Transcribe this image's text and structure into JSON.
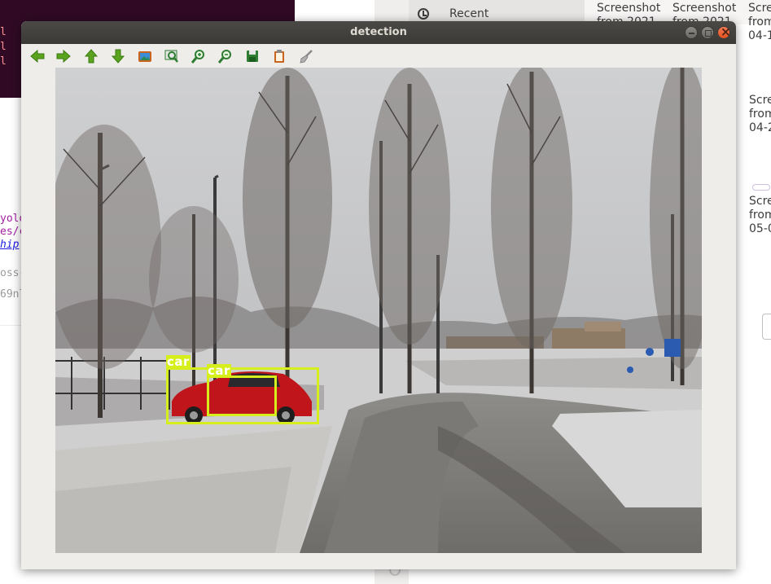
{
  "background": {
    "terminal_lines": [
      "l",
      "l",
      "l"
    ],
    "code_lines": [
      "yolo",
      "es/co",
      "hip"
    ],
    "dim_lines": [
      "oss-",
      "69nl"
    ],
    "sidebar_recent": "Recent",
    "thumbnails": [
      {
        "text": "Screenshot\nfrom 2021"
      },
      {
        "text": "Screenshot\nfrom 2021"
      },
      {
        "text": "Scre\nfrom\n04-1"
      },
      {
        "text": "Scre\nfrom\n04-2"
      },
      {
        "text": "Scre\nfrom\n05-0"
      }
    ]
  },
  "window": {
    "title": "detection",
    "toolbar": [
      {
        "name": "back-arrow-icon",
        "color": "#5aa31e"
      },
      {
        "name": "forward-arrow-icon",
        "color": "#5aa31e"
      },
      {
        "name": "up-arrow-icon",
        "color": "#5aa31e"
      },
      {
        "name": "down-arrow-icon",
        "color": "#5aa31e"
      },
      {
        "name": "image-icon",
        "color": "#2e8b57"
      },
      {
        "name": "zoom-fit-icon",
        "color": "#2e7d32"
      },
      {
        "name": "zoom-in-icon",
        "color": "#2e7d32"
      },
      {
        "name": "zoom-out-icon",
        "color": "#2e7d32"
      },
      {
        "name": "save-icon",
        "color": "#2e7d32"
      },
      {
        "name": "clipboard-icon",
        "color": "#c8641e"
      },
      {
        "name": "brush-icon",
        "color": "#888888"
      }
    ]
  },
  "detections": [
    {
      "label": "car",
      "color": "#d6ee1c"
    },
    {
      "label": "car",
      "color": "#d6ee1c"
    }
  ]
}
